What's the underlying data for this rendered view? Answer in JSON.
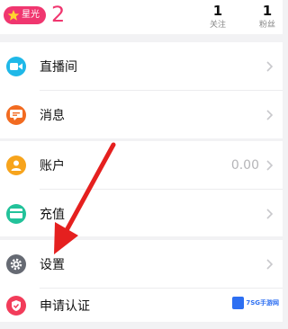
{
  "header": {
    "badge_label": "星光",
    "level": "2",
    "stats": [
      {
        "value": "1",
        "label": "关注"
      },
      {
        "value": "1",
        "label": "粉丝"
      }
    ]
  },
  "menu": [
    {
      "label": "直播间",
      "icon": "video-camera-icon",
      "color": "#1fb8e8"
    },
    {
      "label": "消息",
      "icon": "message-icon",
      "color": "#f26b21"
    },
    {
      "label": "账户",
      "icon": "user-icon",
      "color": "#f7a41c",
      "value": "0.00"
    },
    {
      "label": "充值",
      "icon": "card-icon",
      "color": "#22c29a"
    },
    {
      "label": "设置",
      "icon": "gear-icon",
      "color": "#666a73"
    },
    {
      "label": "申请认证",
      "icon": "verify-icon",
      "color": "#f23c5a"
    }
  ],
  "annotation": {
    "arrow_color": "#e5201f"
  },
  "watermark": {
    "text": "7SG手游网"
  }
}
